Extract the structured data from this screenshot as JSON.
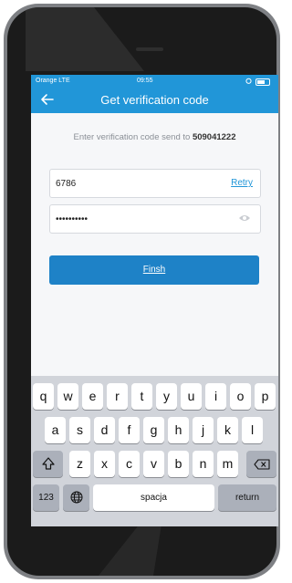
{
  "status": {
    "carrier": "Orange  LTE",
    "time": "09:55"
  },
  "header": {
    "title": "Get verification code"
  },
  "info": {
    "prefix": "Enter verification code send to ",
    "number": "509041222"
  },
  "code_field": {
    "value": "6786",
    "retry_label": "Retry"
  },
  "password_field": {
    "value": "••••••••••"
  },
  "finish_button": {
    "label": "Finsh"
  },
  "keyboard": {
    "row1": [
      "q",
      "w",
      "e",
      "r",
      "t",
      "y",
      "u",
      "i",
      "o",
      "p"
    ],
    "row2": [
      "a",
      "s",
      "d",
      "f",
      "g",
      "h",
      "j",
      "k",
      "l"
    ],
    "row3": [
      "z",
      "x",
      "c",
      "v",
      "b",
      "n",
      "m"
    ],
    "numbers_label": "123",
    "space_label": "spacja",
    "return_label": "return"
  },
  "colors": {
    "accent": "#2196d8",
    "button": "#1e82c7",
    "keyboard": "#d1d4da"
  }
}
